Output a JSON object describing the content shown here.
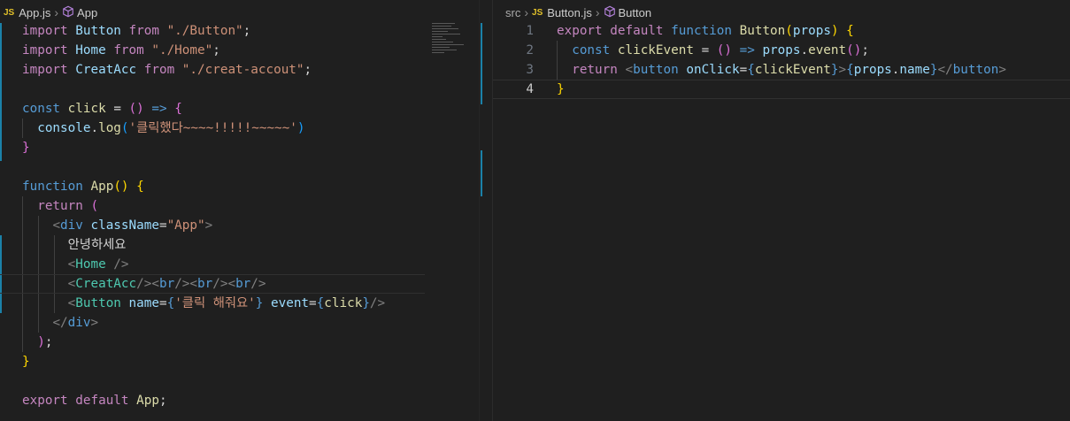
{
  "left_editor": {
    "breadcrumb": {
      "icon": "JS",
      "file": "App.js",
      "symbol": "App"
    },
    "code": {
      "l1": {
        "kw": "import",
        "name": "Button",
        "from": "from",
        "path": "\"./Button\"",
        "end": ";"
      },
      "l2": {
        "kw": "import",
        "name": "Home",
        "from": "from",
        "path": "\"./Home\"",
        "end": ";"
      },
      "l3": {
        "kw": "import",
        "name": "CreatAcc",
        "from": "from",
        "path": "\"./creat-accout\"",
        "end": ";"
      },
      "l5": {
        "kw": "const",
        "name": "click",
        "eq": "=",
        "parens": "()",
        "arrow": "=>",
        "brace": "{"
      },
      "l6": {
        "obj": "console",
        "dot": ".",
        "fn": "log",
        "open": "(",
        "str": "'클릭했다~~~~!!!!!~~~~~'",
        "close": ")"
      },
      "l7": {
        "brace": "}"
      },
      "l9": {
        "kw": "function",
        "name": "App",
        "parens": "()",
        "brace": "{"
      },
      "l10": {
        "kw": "return",
        "paren": "("
      },
      "l11": {
        "lt": "<",
        "tag": "div",
        "attr": "className",
        "eq": "=",
        "val": "\"App\"",
        "gt": ">"
      },
      "l12": {
        "text": "안녕하세요"
      },
      "l13": {
        "lt": "<",
        "tag": "Home",
        "close": " />"
      },
      "l14": {
        "lt1": "<",
        "tag1": "CreatAcc",
        "close1": "/>",
        "lt2": "<",
        "tag2": "br",
        "close2": "/>",
        "lt3": "<",
        "tag3": "br",
        "close3": "/>",
        "lt4": "<",
        "tag4": "br",
        "close4": "/>"
      },
      "l15": {
        "lt": "<",
        "tag": "Button",
        "attr1": "name",
        "eq1": "=",
        "open1": "{",
        "val1": "'클릭 해줘요'",
        "close1": "}",
        "attr2": "event",
        "eq2": "=",
        "open2": "{",
        "val2": "click",
        "close2": "}",
        "end": "/>"
      },
      "l16": {
        "lt": "</",
        "tag": "div",
        "gt": ">"
      },
      "l17": {
        "paren": ")",
        "end": ";"
      },
      "l18": {
        "brace": "}"
      },
      "l20": {
        "kw1": "export",
        "kw2": "default",
        "name": "App",
        "end": ";"
      }
    }
  },
  "right_editor": {
    "breadcrumb": {
      "folder": "src",
      "icon": "JS",
      "file": "Button.js",
      "symbol": "Button"
    },
    "line_numbers": [
      "1",
      "2",
      "3",
      "4"
    ],
    "code": {
      "l1": {
        "kw1": "export",
        "kw2": "default",
        "kw3": "function",
        "name": "Button",
        "open": "(",
        "param": "props",
        "close": ")",
        "brace": "{"
      },
      "l2": {
        "kw": "const",
        "name": "clickEvent",
        "eq": "=",
        "parens": "()",
        "arrow": "=>",
        "obj": "props",
        "dot": ".",
        "fn": "event",
        "call": "()",
        "end": ";"
      },
      "l3": {
        "kw": "return",
        "lt": "<",
        "tag": "button",
        "attr": "onClick",
        "eq": "=",
        "open1": "{",
        "val1": "clickEvent",
        "close1": "}",
        "gt": ">",
        "open2": "{",
        "obj": "props",
        "dot": ".",
        "prop": "name",
        "close2": "}",
        "endtag": "</",
        "tag2": "button",
        "gt2": ">"
      },
      "l4": {
        "brace": "}"
      }
    }
  },
  "colors": {
    "background": "#1f1f1f",
    "keyword": "#c586c0",
    "storage": "#569cd6",
    "function": "#dcdcaa",
    "variable": "#9cdcfe",
    "string": "#ce9178",
    "component": "#4ec9b0",
    "bracket_gold": "#ffd700",
    "bracket_orchid": "#da70d6",
    "bracket_blue": "#179fff",
    "gutter_modified": "#1b81a8"
  },
  "icons": [
    "js-file-icon",
    "chevron-right-icon",
    "symbol-cube-icon"
  ]
}
